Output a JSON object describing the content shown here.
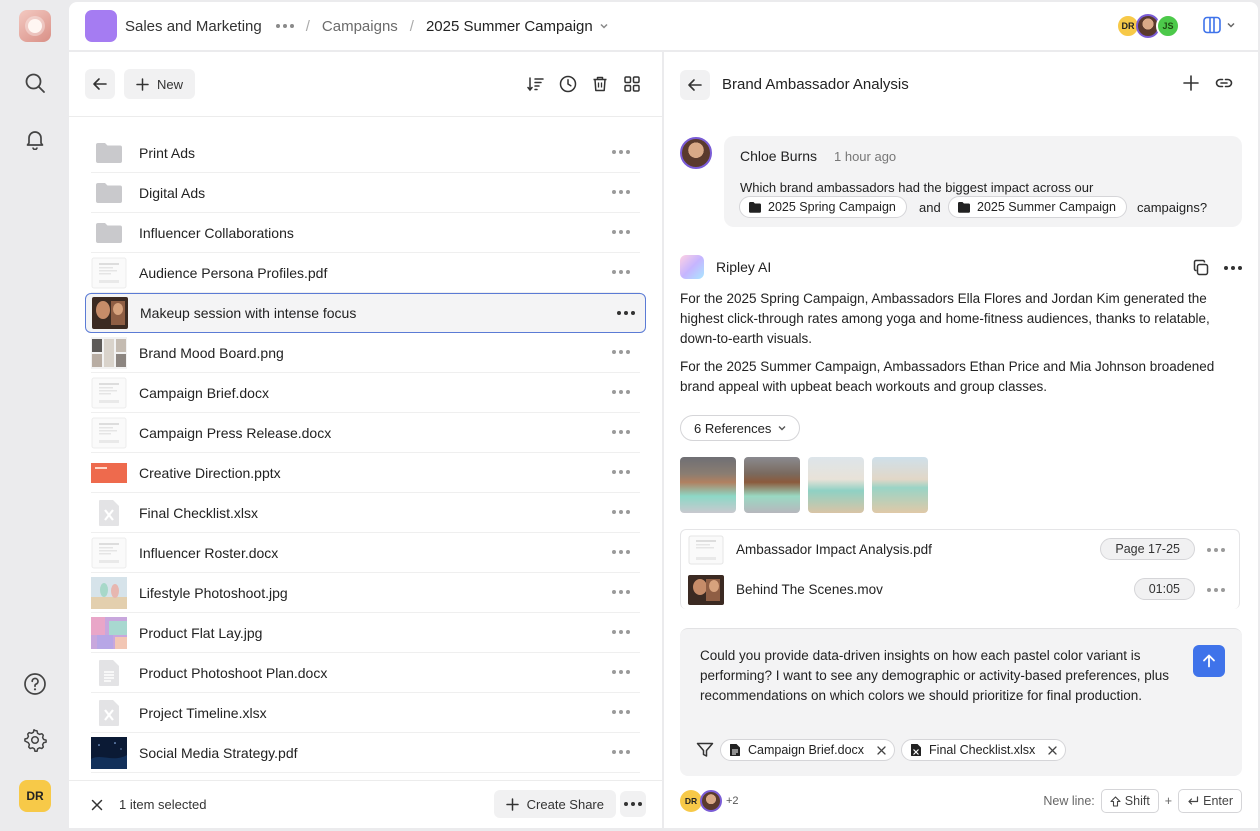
{
  "rail": {
    "logo": "app-logo",
    "icons": [
      "search-icon",
      "bell-icon",
      "help-icon",
      "gear-icon"
    ],
    "user_initials": "DR"
  },
  "topbar": {
    "workspace": "Sales and Marketing",
    "crumb_2": "Campaigns",
    "crumb_3": "2025 Summer Campaign",
    "avatars": [
      {
        "initials": "DR",
        "color": "#f7c948"
      },
      {
        "initials": "",
        "color": "#7a5cd6"
      },
      {
        "initials": "JS",
        "color": "#4cc94a"
      }
    ]
  },
  "left": {
    "new_label": "New",
    "files": [
      {
        "name": "Print Ads",
        "kind": "folder"
      },
      {
        "name": "Digital Ads",
        "kind": "folder"
      },
      {
        "name": "Influencer Collaborations",
        "kind": "folder"
      },
      {
        "name": "Audience Persona Profiles.pdf",
        "kind": "doc"
      },
      {
        "name": "Makeup session with intense focus",
        "kind": "photo-dark",
        "selected": true
      },
      {
        "name": "Brand Mood Board.png",
        "kind": "photo-mood"
      },
      {
        "name": "Campaign Brief.docx",
        "kind": "doc"
      },
      {
        "name": "Campaign Press Release.docx",
        "kind": "doc"
      },
      {
        "name": "Creative Direction.pptx",
        "kind": "slide"
      },
      {
        "name": "Final Checklist.xlsx",
        "kind": "xlsx"
      },
      {
        "name": "Influencer Roster.docx",
        "kind": "doc"
      },
      {
        "name": "Lifestyle Photoshoot.jpg",
        "kind": "photo-beach"
      },
      {
        "name": "Product Flat Lay.jpg",
        "kind": "photo-pastel"
      },
      {
        "name": "Product Photoshoot Plan.docx",
        "kind": "docx-icon"
      },
      {
        "name": "Project Timeline.xlsx",
        "kind": "xlsx"
      },
      {
        "name": "Social Media Strategy.pdf",
        "kind": "photo-night"
      }
    ],
    "footer": {
      "selected_text": "1 item selected",
      "share_label": "Create Share"
    }
  },
  "right": {
    "title": "Brand Ambassador Analysis",
    "user_msg": {
      "name": "Chloe Burns",
      "time": "1 hour ago",
      "text": "Which brand ambassadors had the biggest impact across our",
      "chip_1": "2025 Spring Campaign",
      "and": "and",
      "chip_2": "2025 Summer Campaign",
      "tail": "campaigns?"
    },
    "ai": {
      "name": "Ripley AI",
      "para_1": "For the 2025 Spring Campaign, Ambassadors Ella Flores and Jordan Kim generated the highest click-through rates among yoga and home-fitness audiences, thanks to relatable, down-to-earth visuals.",
      "para_2": "For the 2025 Summer Campaign, Ambassadors Ethan Price and Mia Johnson broadened brand appeal with upbeat beach workouts and group classes.",
      "refs_label": "6 References"
    },
    "references": [
      {
        "name": "Ambassador Impact Analysis.pdf",
        "badge": "Page 17-25"
      },
      {
        "name": "Behind The Scenes.mov",
        "badge": "01:05"
      }
    ],
    "input": {
      "text": "Could you provide data-driven insights on how each pastel color variant is performing? I want to see any demographic or activity-based preferences, plus recommendations on which colors we should prioritize for final production.",
      "attachments": [
        "Campaign Brief.docx",
        "Final Checklist.xlsx"
      ]
    },
    "footer": {
      "initials": "DR",
      "more": "+2",
      "newline_label": "New line:",
      "key_1": "Shift",
      "plus": "+",
      "key_2": "Enter"
    }
  },
  "colors": {
    "accent": "#3f73ea",
    "workspace": "#a57cf2",
    "selection_border": "#5b7bd5"
  }
}
